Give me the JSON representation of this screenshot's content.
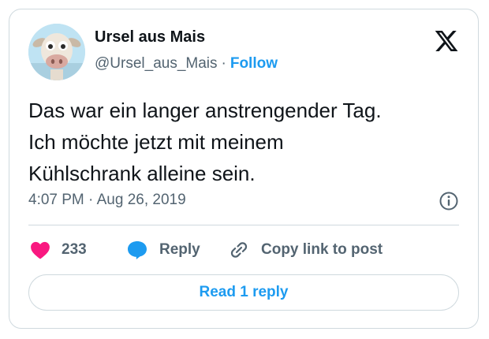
{
  "author": {
    "name": "Ursel aus Mais",
    "handle": "@Ursel_aus_Mais",
    "separator": "·",
    "follow_label": "Follow"
  },
  "tweet": {
    "lines": [
      "Das war ein langer anstrengender Tag.",
      "Ich möchte jetzt mit meinem",
      "Kühlschrank alleine sein."
    ],
    "time": "4:07 PM",
    "date_separator": "·",
    "date": "Aug 26, 2019"
  },
  "actions": {
    "likes_count": "233",
    "reply_label": "Reply",
    "copy_link_label": "Copy link to post"
  },
  "read_replies_label": "Read 1 reply",
  "icons": {
    "platform": "x-logo-icon",
    "info": "info-icon",
    "like": "heart-icon",
    "reply": "speech-bubble-icon",
    "copy": "link-icon"
  },
  "colors": {
    "accent": "#1d9bf0",
    "like": "#f91880",
    "text": "#0f1419",
    "muted": "#536471",
    "border": "#cfd9de"
  }
}
